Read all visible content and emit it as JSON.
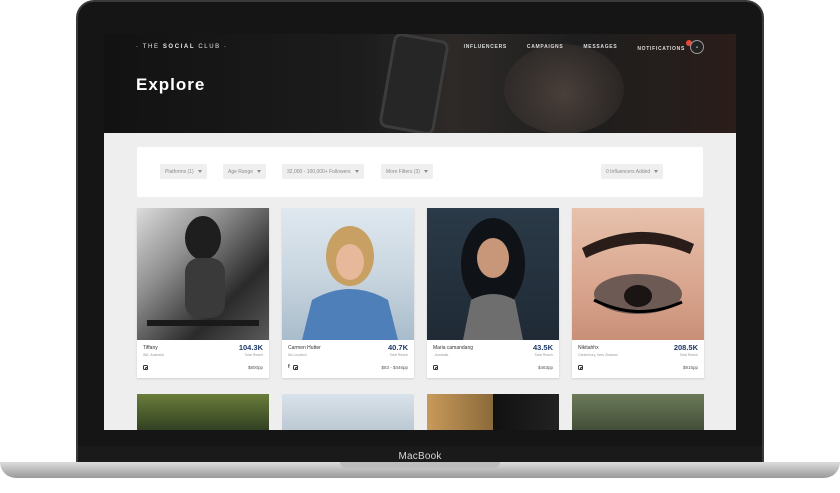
{
  "device": {
    "brand": "MacBook"
  },
  "header": {
    "logo_prefix": "· THE ",
    "logo_bold": "SOCIAL",
    "logo_suffix": " CLUB ·",
    "nav": [
      "INFLUENCERS",
      "CAMPAIGNS",
      "MESSAGES",
      "NOTIFICATIONS"
    ],
    "title": "Explore"
  },
  "filters": {
    "platforms": "Platforms (1)",
    "age_range": "Age Range",
    "followers": "32,000 - 100,000+ Followers",
    "more_filters": "More Filters (3)",
    "influencers_added": "0 Influencers Added"
  },
  "cards": [
    {
      "name": "Tiffany",
      "location": "WA, Australia",
      "reach": "104.3K",
      "reach_label": "Total Reach",
      "price": "$800pp",
      "platforms": [
        "instagram"
      ]
    },
    {
      "name": "Carmen Hutter",
      "location": "No Location",
      "reach": "40.7K",
      "reach_label": "Total Reach",
      "price": "$83 - $446pp",
      "platforms": [
        "facebook",
        "instagram"
      ]
    },
    {
      "name": "Maria camandang",
      "location": ", Australia",
      "reach": "43.5K",
      "reach_label": "Total Reach",
      "price": "$463pp",
      "platforms": [
        "instagram"
      ]
    },
    {
      "name": "Nikitahhx",
      "location": "Canterbury, New Zealand",
      "reach": "208.5K",
      "reach_label": "Total Reach",
      "price": "$915pp",
      "platforms": [
        "instagram"
      ]
    }
  ],
  "colors": {
    "accent": "#1f3a6a",
    "notification": "#e8483c"
  },
  "icons": [
    "instagram-icon",
    "facebook-icon",
    "caret-down-icon",
    "avatar"
  ]
}
